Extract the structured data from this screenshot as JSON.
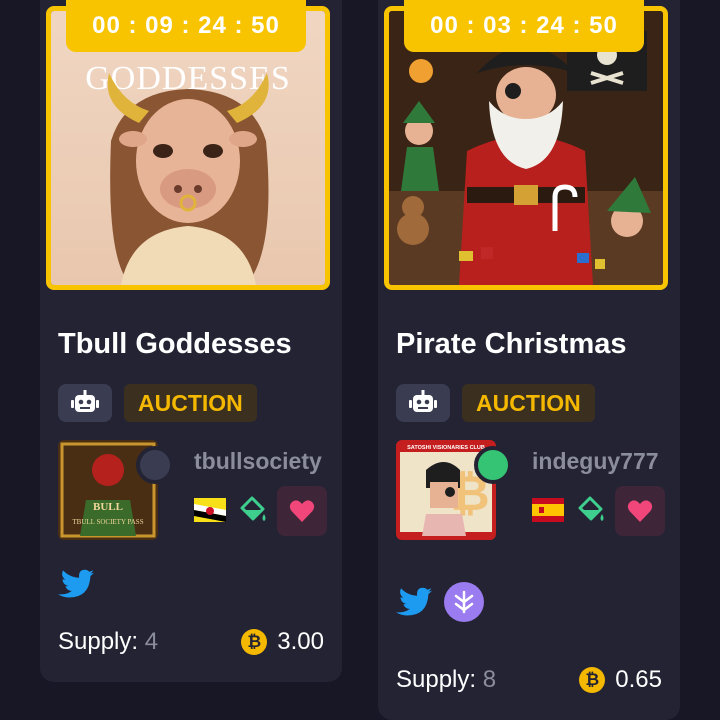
{
  "cards": [
    {
      "timer": "00 : 09 : 24 : 50",
      "image_text": "GODDESSES",
      "title": "Tbull Goddesses",
      "badge": "AUCTION",
      "avatar_text_top": "BULL",
      "avatar_text_bottom": "TBULL SOCIETY PASS",
      "creator": "tbullsociety",
      "status_color": "#3a3c52",
      "flag": "brunei-flag",
      "socials": [
        "twitter-icon"
      ],
      "supply_label": "Supply:",
      "supply_value": "4",
      "price": "3.00"
    },
    {
      "timer": "00 : 03 : 24 : 50",
      "title": "Pirate Christmas",
      "badge": "AUCTION",
      "avatar_text_top": "SATOSHI VISIONARIES CLUB",
      "creator": "indeguy777",
      "status_color": "#34c474",
      "flag": "spain-flag",
      "socials": [
        "twitter-icon",
        "magic-eden-icon"
      ],
      "supply_label": "Supply:",
      "supply_value": "8",
      "price": "0.65"
    }
  ],
  "colors": {
    "background": "#171726",
    "card": "#232334",
    "accent": "#f8c400",
    "auction": "#f5b800",
    "heart": "#f0467a",
    "paint": "#3ecf8e",
    "twitter": "#1d9bf0"
  }
}
